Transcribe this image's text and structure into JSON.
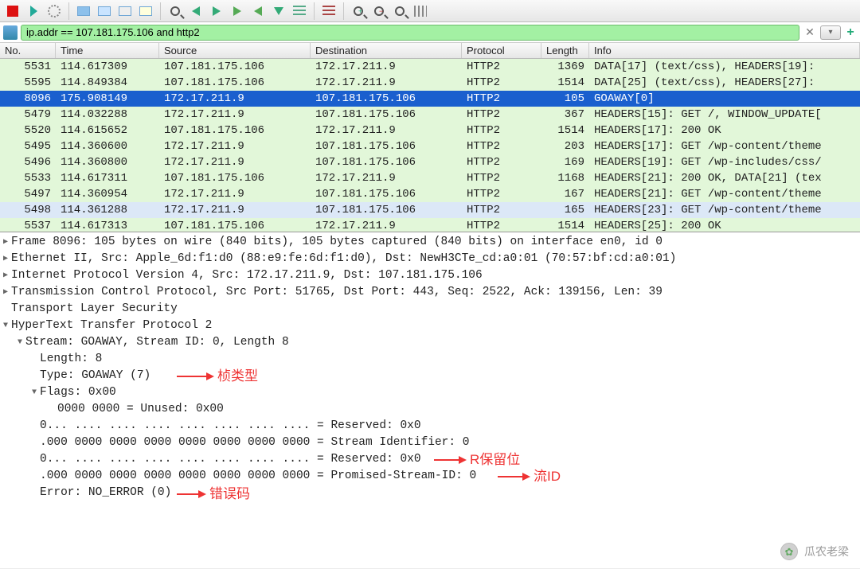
{
  "filter": {
    "value": "ip.addr == 107.181.175.106 and http2"
  },
  "columns": {
    "no": "No.",
    "time": "Time",
    "source": "Source",
    "destination": "Destination",
    "protocol": "Protocol",
    "length": "Length",
    "info": "Info"
  },
  "packets": [
    {
      "no": "5531",
      "time": "114.617309",
      "src": "107.181.175.106",
      "dst": "172.17.211.9",
      "proto": "HTTP2",
      "len": "1369",
      "info": "DATA[17] (text/css), HEADERS[19]:",
      "cls": "green"
    },
    {
      "no": "5595",
      "time": "114.849384",
      "src": "107.181.175.106",
      "dst": "172.17.211.9",
      "proto": "HTTP2",
      "len": "1514",
      "info": "DATA[25] (text/css), HEADERS[27]:",
      "cls": "green"
    },
    {
      "no": "8096",
      "time": "175.908149",
      "src": "172.17.211.9",
      "dst": "107.181.175.106",
      "proto": "HTTP2",
      "len": "105",
      "info": "GOAWAY[0]",
      "cls": "sel"
    },
    {
      "no": "5479",
      "time": "114.032288",
      "src": "172.17.211.9",
      "dst": "107.181.175.106",
      "proto": "HTTP2",
      "len": "367",
      "info": "HEADERS[15]: GET /, WINDOW_UPDATE[",
      "cls": "green"
    },
    {
      "no": "5520",
      "time": "114.615652",
      "src": "107.181.175.106",
      "dst": "172.17.211.9",
      "proto": "HTTP2",
      "len": "1514",
      "info": "HEADERS[17]: 200 OK",
      "cls": "green"
    },
    {
      "no": "5495",
      "time": "114.360600",
      "src": "172.17.211.9",
      "dst": "107.181.175.106",
      "proto": "HTTP2",
      "len": "203",
      "info": "HEADERS[17]: GET /wp-content/theme",
      "cls": "green"
    },
    {
      "no": "5496",
      "time": "114.360800",
      "src": "172.17.211.9",
      "dst": "107.181.175.106",
      "proto": "HTTP2",
      "len": "169",
      "info": "HEADERS[19]: GET /wp-includes/css/",
      "cls": "green"
    },
    {
      "no": "5533",
      "time": "114.617311",
      "src": "107.181.175.106",
      "dst": "172.17.211.9",
      "proto": "HTTP2",
      "len": "1168",
      "info": "HEADERS[21]: 200 OK, DATA[21] (tex",
      "cls": "green"
    },
    {
      "no": "5497",
      "time": "114.360954",
      "src": "172.17.211.9",
      "dst": "107.181.175.106",
      "proto": "HTTP2",
      "len": "167",
      "info": "HEADERS[21]: GET /wp-content/theme",
      "cls": "green"
    },
    {
      "no": "5498",
      "time": "114.361288",
      "src": "172.17.211.9",
      "dst": "107.181.175.106",
      "proto": "HTTP2",
      "len": "165",
      "info": "HEADERS[23]: GET /wp-content/theme",
      "cls": "blue"
    },
    {
      "no": "5537",
      "time": "114.617313",
      "src": "107.181.175.106",
      "dst": "172.17.211.9",
      "proto": "HTTP2",
      "len": "1514",
      "info": "HEADERS[25]: 200 OK",
      "cls": "green"
    }
  ],
  "tree": {
    "frame": "Frame 8096: 105 bytes on wire (840 bits), 105 bytes captured (840 bits) on interface en0, id 0",
    "eth": "Ethernet II, Src: Apple_6d:f1:d0 (88:e9:fe:6d:f1:d0), Dst: NewH3CTe_cd:a0:01 (70:57:bf:cd:a0:01)",
    "ip": "Internet Protocol Version 4, Src: 172.17.211.9, Dst: 107.181.175.106",
    "tcp": "Transmission Control Protocol, Src Port: 51765, Dst Port: 443, Seq: 2522, Ack: 139156, Len: 39",
    "tls": "Transport Layer Security",
    "http2": "HyperText Transfer Protocol 2",
    "stream": "Stream: GOAWAY, Stream ID: 0, Length 8",
    "length": "Length: 8",
    "type": "Type: GOAWAY (7)",
    "flags": "Flags: 0x00",
    "unused": "0000 0000 = Unused: 0x00",
    "reserved1": "0... .... .... .... .... .... .... .... = Reserved: 0x0",
    "streamid": ".000 0000 0000 0000 0000 0000 0000 0000 = Stream Identifier: 0",
    "reserved2": "0... .... .... .... .... .... .... .... = Reserved: 0x0",
    "promised": ".000 0000 0000 0000 0000 0000 0000 0000 = Promised-Stream-ID: 0",
    "error": "Error: NO_ERROR (0)"
  },
  "annotations": {
    "frameType": "桢类型",
    "reservedBit": "R保留位",
    "streamId": "流ID",
    "errorCode": "错误码"
  },
  "watermark": "瓜农老梁"
}
